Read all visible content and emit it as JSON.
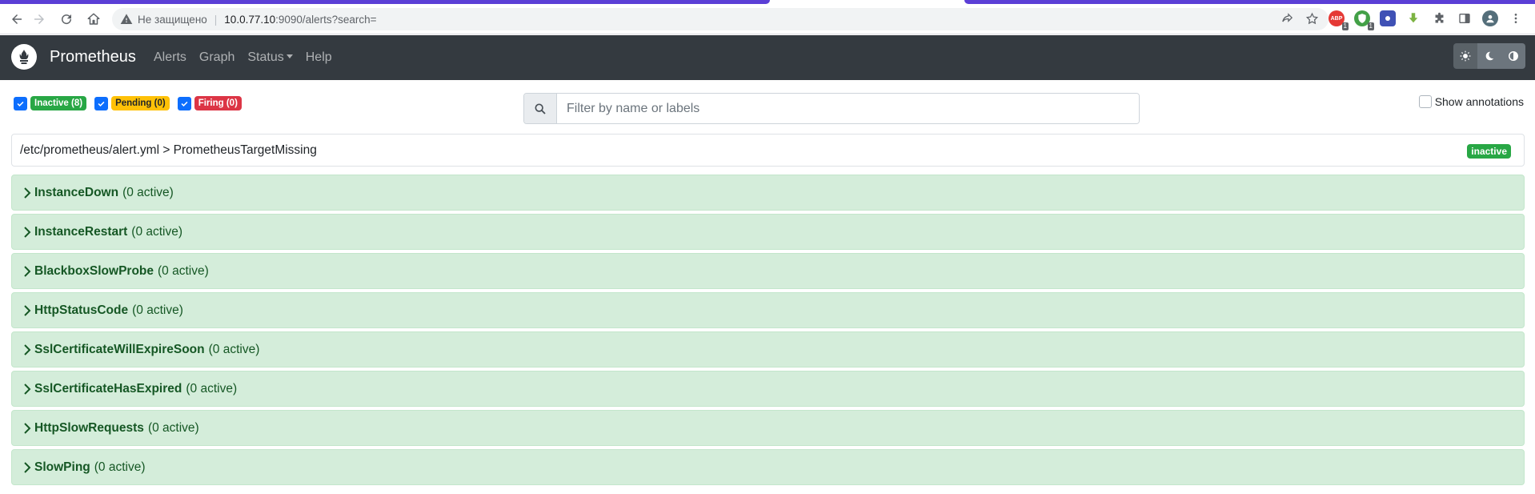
{
  "browser": {
    "security_text": "Не защищено",
    "url_host": "10.0.77.10",
    "url_path": ":9090/alerts?search=",
    "extension_badge_1": "1",
    "extension_badge_2": "1"
  },
  "navbar": {
    "brand": "Prometheus",
    "links": [
      "Alerts",
      "Graph",
      "Status",
      "Help"
    ]
  },
  "filters": {
    "inactive_label": "Inactive (8)",
    "pending_label": "Pending (0)",
    "firing_label": "Firing (0)",
    "search_placeholder": "Filter by name or labels",
    "search_value": "",
    "show_annotations_label": "Show annotations"
  },
  "group": {
    "path": "/etc/prometheus/alert.yml > PrometheusTargetMissing",
    "state": "inactive"
  },
  "rules": [
    {
      "name": "InstanceDown",
      "count": "(0 active)"
    },
    {
      "name": "InstanceRestart",
      "count": "(0 active)"
    },
    {
      "name": "BlackboxSlowProbe",
      "count": "(0 active)"
    },
    {
      "name": "HttpStatusCode",
      "count": "(0 active)"
    },
    {
      "name": "SslCertificateWillExpireSoon",
      "count": "(0 active)"
    },
    {
      "name": "SslCertificateHasExpired",
      "count": "(0 active)"
    },
    {
      "name": "HttpSlowRequests",
      "count": "(0 active)"
    },
    {
      "name": "SlowPing",
      "count": "(0 active)"
    }
  ],
  "colors": {
    "navbar_bg": "#343a40",
    "inactive": "#28a745",
    "pending": "#ffc107",
    "firing": "#dc3545",
    "rule_bg": "#d4edda",
    "rule_text": "#155724"
  }
}
